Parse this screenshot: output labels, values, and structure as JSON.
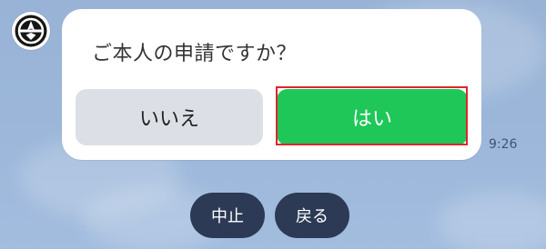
{
  "chat": {
    "question": "ご本人の申請ですか？",
    "timestamp": "9:26",
    "no_label": "いいえ",
    "yes_label": "はい"
  },
  "actions": {
    "cancel_label": "中止",
    "back_label": "戻る"
  },
  "colors": {
    "yes": "#1fc758",
    "no": "#dddfe6",
    "highlight": "#e0242b",
    "action_pill": "#2c3a55",
    "background": "#9cb7da"
  },
  "icons": {
    "avatar": "emblem-icon"
  }
}
